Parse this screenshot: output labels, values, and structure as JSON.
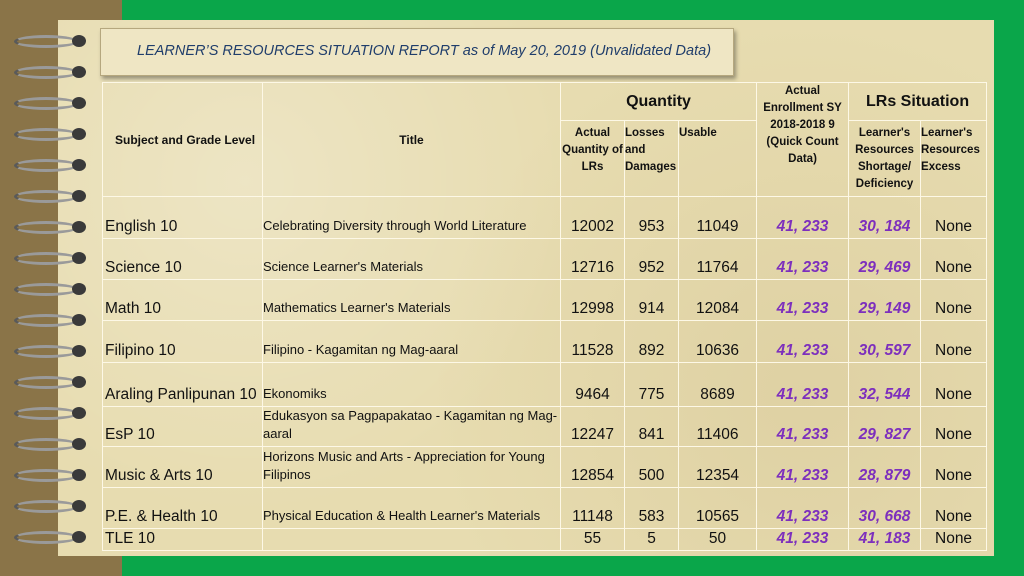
{
  "report_title": "LEARNER’S RESOURCES SITUATION REPORT as of May 20, 2019 (Unvalidated Data)",
  "headers": {
    "subject": "Subject and Grade Level",
    "title": "Title",
    "quantity": "Quantity",
    "actual_quantity": "Actual Quantity of LRs",
    "losses": "Losses and Damages",
    "usable": "Usable",
    "enrollment": "Actual Enrollment SY 2018-2018 9 (Quick Count Data)",
    "lrs_situation": "LRs Situation",
    "shortage": "Learner's Resources Shortage/ Deficiency",
    "excess": "Learner's Resources Excess"
  },
  "rows": [
    {
      "subject": "English 10",
      "title": "Celebrating Diversity through World Literature",
      "actual": "12002",
      "losses": "953",
      "usable": "11049",
      "enrollment": "41, 233",
      "shortage": "30, 184",
      "excess": "None"
    },
    {
      "subject": "Science 10",
      "title": "Science Learner's Materials",
      "actual": "12716",
      "losses": "952",
      "usable": "11764",
      "enrollment": "41, 233",
      "shortage": "29, 469",
      "excess": "None"
    },
    {
      "subject": "Math 10",
      "title": "Mathematics Learner's Materials",
      "actual": "12998",
      "losses": "914",
      "usable": "12084",
      "enrollment": "41, 233",
      "shortage": "29, 149",
      "excess": "None"
    },
    {
      "subject": "Filipino 10",
      "title": "Filipino  - Kagamitan ng Mag-aaral",
      "actual": "11528",
      "losses": "892",
      "usable": "10636",
      "enrollment": "41, 233",
      "shortage": "30, 597",
      "excess": "None"
    },
    {
      "subject": "Araling Panlipunan 10",
      "title": "Ekonomiks",
      "actual": "9464",
      "losses": "775",
      "usable": "8689",
      "enrollment": "41, 233",
      "shortage": "32, 544",
      "excess": "None"
    },
    {
      "subject": "EsP 10",
      "title": "Edukasyon sa Pagpapakatao - Kagamitan ng Mag-aaral",
      "actual": "12247",
      "losses": "841",
      "usable": "11406",
      "enrollment": "41, 233",
      "shortage": "29, 827",
      "excess": "None"
    },
    {
      "subject": "Music & Arts 10",
      "title": "Horizons Music and Arts - Appreciation for Young Filipinos",
      "actual": "12854",
      "losses": "500",
      "usable": "12354",
      "enrollment": "41, 233",
      "shortage": "28, 879",
      "excess": "None"
    },
    {
      "subject": "P.E. & Health 10",
      "title": "Physical Education & Health Learner's Materials",
      "actual": "11148",
      "losses": "583",
      "usable": "10565",
      "enrollment": "41, 233",
      "shortage": "30, 668",
      "excess": "None"
    },
    {
      "subject": "TLE 10",
      "title": "",
      "actual": "55",
      "losses": "5",
      "usable": "50",
      "enrollment": "41, 233",
      "shortage": "41, 183",
      "excess": "None"
    }
  ]
}
